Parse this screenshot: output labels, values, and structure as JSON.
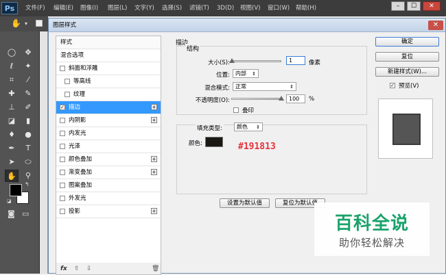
{
  "app": {
    "logo": "Ps",
    "menu": [
      "文件(F)",
      "编辑(E)",
      "图像(I)",
      "图层(L)",
      "文字(Y)",
      "选择(S)",
      "滤镜(T)",
      "3D(D)",
      "视图(V)",
      "窗口(W)",
      "帮助(H)"
    ],
    "window_buttons": [
      "–",
      "☐",
      "✕"
    ]
  },
  "toolbox": {
    "tools": [
      {
        "icon": "move-icon",
        "glyph": "✥"
      },
      {
        "icon": "marquee-icon",
        "glyph": "◯"
      },
      {
        "icon": "lasso-icon",
        "glyph": "ℓ"
      },
      {
        "icon": "magic-wand-icon",
        "glyph": "✦"
      },
      {
        "icon": "crop-icon",
        "glyph": "⌗"
      },
      {
        "icon": "eyedropper-icon",
        "glyph": "⁄"
      },
      {
        "icon": "healing-icon",
        "glyph": "✚"
      },
      {
        "icon": "brush-icon",
        "glyph": "✎"
      },
      {
        "icon": "stamp-icon",
        "glyph": "⊥"
      },
      {
        "icon": "history-brush-icon",
        "glyph": "✐"
      },
      {
        "icon": "eraser-icon",
        "glyph": "◪"
      },
      {
        "icon": "gradient-icon",
        "glyph": "▮"
      },
      {
        "icon": "blur-icon",
        "glyph": "♦"
      },
      {
        "icon": "dodge-icon",
        "glyph": "●"
      },
      {
        "icon": "pen-icon",
        "glyph": "✒"
      },
      {
        "icon": "type-icon",
        "glyph": "T"
      },
      {
        "icon": "path-select-icon",
        "glyph": "➤"
      },
      {
        "icon": "shape-icon",
        "glyph": "⬭"
      },
      {
        "icon": "hand-icon",
        "glyph": "✋"
      },
      {
        "icon": "zoom-icon",
        "glyph": "⚲"
      }
    ],
    "foreground_color": "#000000",
    "background_color": "#ffffff"
  },
  "dialog": {
    "title": "图层样式",
    "close": "✕",
    "styles_header": "样式",
    "blend_options": "混合选项",
    "styles": [
      {
        "label": "斜面和浮雕",
        "checked": false,
        "indent": false,
        "plus": false
      },
      {
        "label": "等高线",
        "checked": false,
        "indent": true,
        "plus": false
      },
      {
        "label": "纹理",
        "checked": false,
        "indent": true,
        "plus": false
      },
      {
        "label": "描边",
        "checked": true,
        "indent": false,
        "plus": true,
        "selected": true
      },
      {
        "label": "内阴影",
        "checked": false,
        "indent": false,
        "plus": true
      },
      {
        "label": "内发光",
        "checked": false,
        "indent": false,
        "plus": false
      },
      {
        "label": "光泽",
        "checked": false,
        "indent": false,
        "plus": false
      },
      {
        "label": "颜色叠加",
        "checked": false,
        "indent": false,
        "plus": true
      },
      {
        "label": "渐变叠加",
        "checked": false,
        "indent": false,
        "plus": true
      },
      {
        "label": "图案叠加",
        "checked": false,
        "indent": false,
        "plus": false
      },
      {
        "label": "外发光",
        "checked": false,
        "indent": false,
        "plus": false
      },
      {
        "label": "投影",
        "checked": false,
        "indent": false,
        "plus": true
      }
    ],
    "footer": {
      "fx": "fx",
      "up": "⇧",
      "down": "⇩",
      "trash": "🗑"
    },
    "stroke": {
      "title": "描边",
      "structure_title": "结构",
      "size_label": "大小(S):",
      "size_value": "1",
      "size_unit": "像素",
      "position_label": "位置:",
      "position_value": "内部",
      "blend_label": "混合模式:",
      "blend_value": "正常",
      "opacity_label": "不透明度(O):",
      "opacity_value": "100",
      "opacity_unit": "%",
      "emboss_label": "叠印",
      "fill_type_label": "填充类型:",
      "fill_type_value": "颜色",
      "color_label": "颜色:",
      "color_value": "#191813",
      "set_default": "设置为默认值",
      "reset_default": "复位为默认值"
    },
    "buttons": {
      "ok": "确定",
      "reset": "复位",
      "new_style": "新建样式(W)...",
      "preview_label": "预览(V)",
      "preview_checked": true
    },
    "annotation": "#191813"
  },
  "watermark": {
    "title": "百科全说",
    "subtitle": "助你轻松解决"
  },
  "colors": {
    "selection": "#3399ff",
    "annotation": "#e8313a",
    "watermark_green": "#1aa36b",
    "stroke_swatch": "#191813"
  }
}
